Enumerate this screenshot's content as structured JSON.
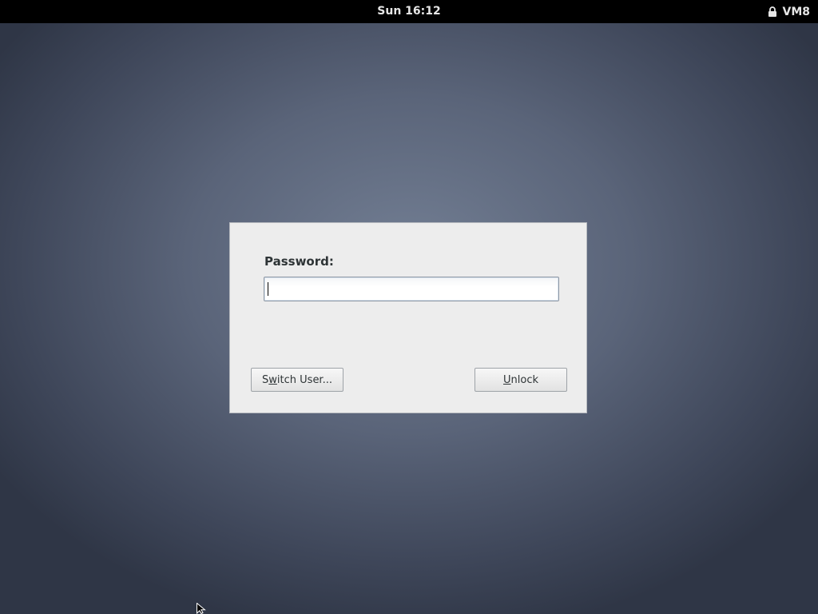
{
  "topbar": {
    "clock": "Sun 16:12",
    "user": "VM8",
    "lock_icon": "lock-icon"
  },
  "dialog": {
    "password_label": "Password:",
    "password_value": "",
    "switch_user": {
      "prefix": "S",
      "mnemonic": "w",
      "rest": "itch User..."
    },
    "unlock": {
      "prefix": "",
      "mnemonic": "U",
      "rest": "nlock"
    }
  },
  "colors": {
    "background_center": "#737f94",
    "background_edge": "#2f3646",
    "topbar": "#000000",
    "dialog": "#ededed"
  }
}
